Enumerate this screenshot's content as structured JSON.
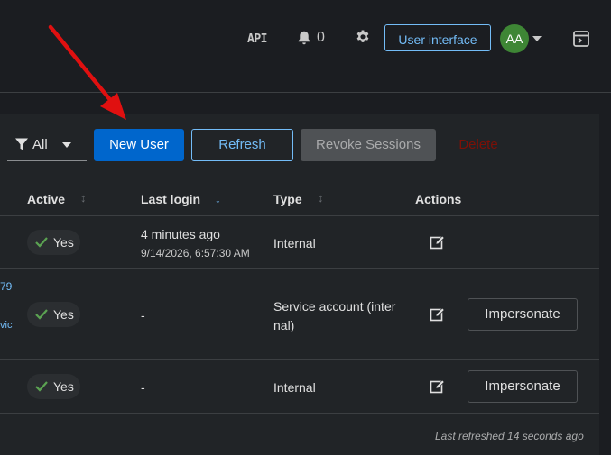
{
  "header": {
    "api_label": "API",
    "notification_count": "0",
    "user_interface_label": "User interface",
    "avatar_initials": "AA",
    "avatar_color": "#3e8635"
  },
  "toolbar": {
    "filter_label": "All",
    "new_user_label": "New User",
    "refresh_label": "Refresh",
    "revoke_sessions_label": "Revoke Sessions",
    "delete_label": "Delete"
  },
  "columns": {
    "active": "Active",
    "last_login": "Last login",
    "type": "Type",
    "actions": "Actions"
  },
  "rows": [
    {
      "active": "Yes",
      "last_login": "4 minutes ago",
      "last_login_detail": "9/14/2026, 6:57:30 AM",
      "type": "Internal",
      "has_impersonate": false
    },
    {
      "name_fragment_top": "79",
      "name_fragment_bottom": "vic",
      "active": "Yes",
      "last_login": "-",
      "type_line1": "Service account (inter",
      "type_line2": "nal)",
      "impersonate_label": "Impersonate"
    },
    {
      "active": "Yes",
      "last_login": "-",
      "type": "Internal",
      "impersonate_label": "Impersonate"
    }
  ],
  "footer": {
    "last_refreshed": "Last refreshed 14 seconds ago"
  },
  "colors": {
    "primary": "#0066cc",
    "link": "#73bcf7",
    "success": "#3e8635",
    "annotation_arrow": "#e01010"
  }
}
